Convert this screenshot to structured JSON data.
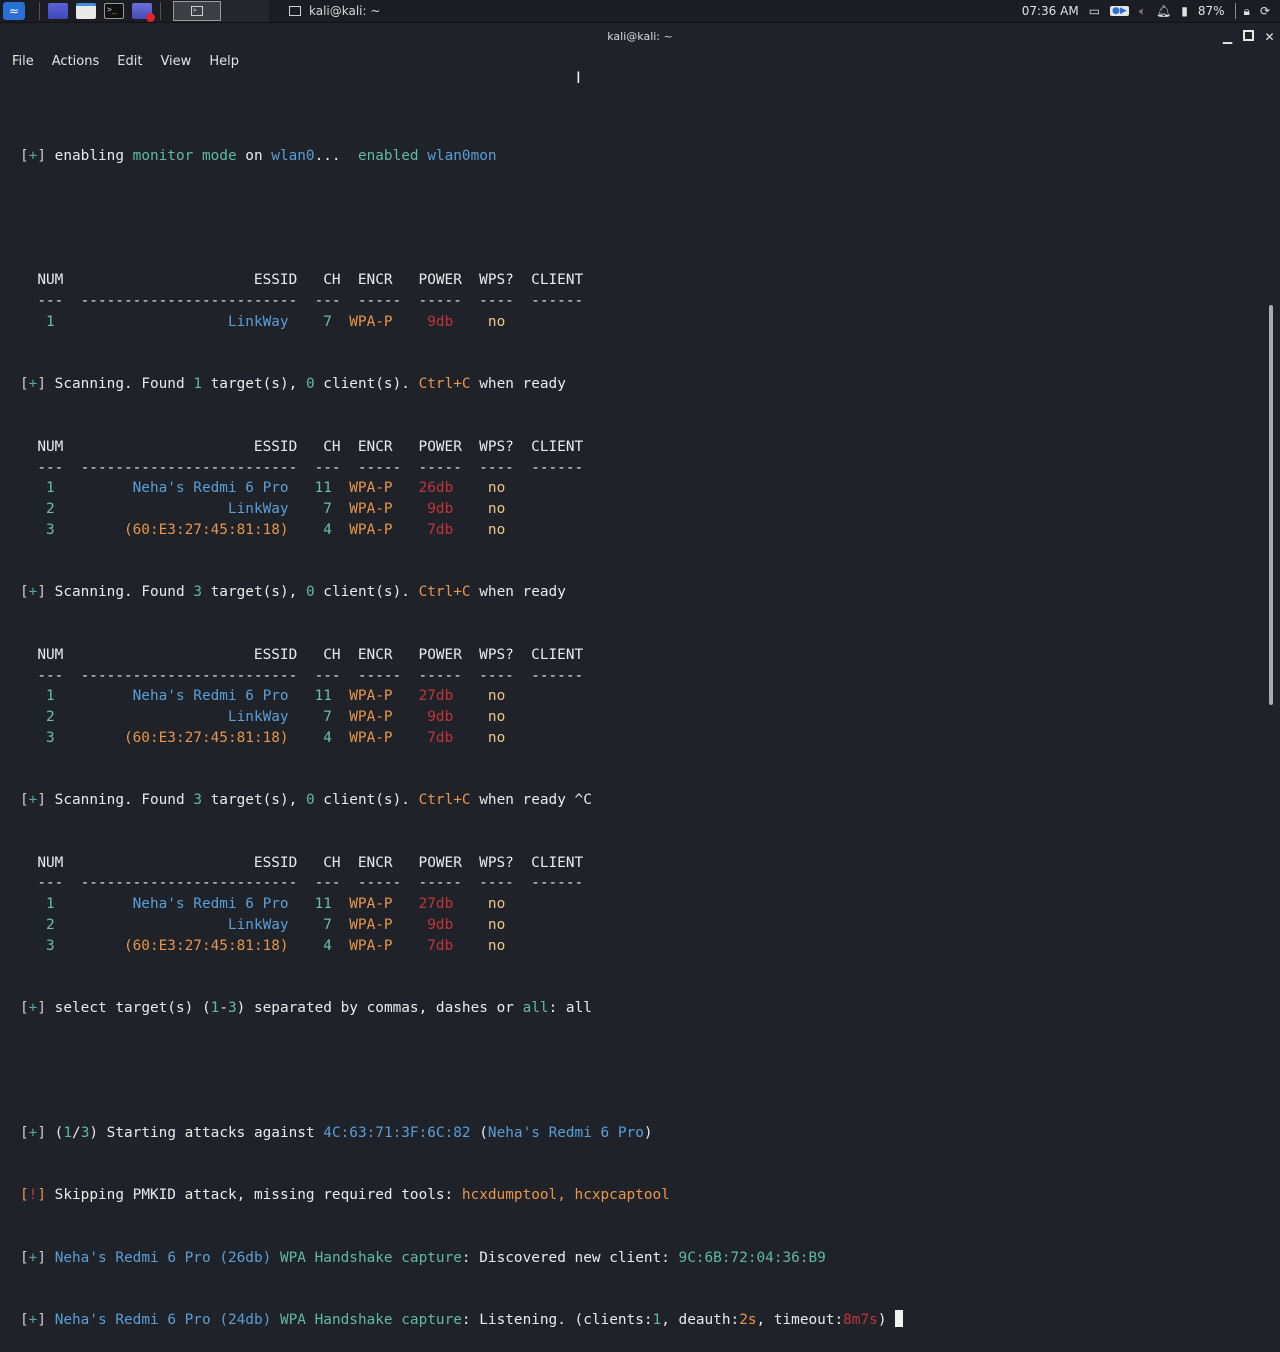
{
  "panel": {
    "taskbar_title": "kali@kali: ~",
    "tray": {
      "time": "07:36 AM",
      "battery": "87%"
    }
  },
  "window": {
    "title": "kali@kali: ~",
    "minimize": "▁",
    "close": "✕"
  },
  "menu": [
    "File",
    "Actions",
    "Edit",
    "View",
    "Help"
  ],
  "terminal": {
    "monitor_line": {
      "prefix": "[+]",
      "t1": " enabling ",
      "t2": "monitor mode",
      "t3": " on ",
      "t4": "wlan0",
      "t5": "...  ",
      "t6": "enabled",
      "t7": " ",
      "t8": "wlan0mon"
    },
    "header": "  NUM                      ESSID   CH  ENCR   POWER  WPS?  CLIENT",
    "divider": "  ---  -------------------------  ---  -----  -----  ----  ------",
    "scan1_rows": [
      {
        "num": "1",
        "essid": "LinkWay",
        "ch": "7",
        "encr": "WPA-P",
        "power": "9db",
        "wps": "no"
      }
    ],
    "scan1_status": {
      "found": "1",
      "clients": "0"
    },
    "scan2_rows": [
      {
        "num": "1",
        "essid": "Neha's Redmi 6 Pro",
        "ch": "11",
        "encr": "WPA-P",
        "power": "26db",
        "wps": "no"
      },
      {
        "num": "2",
        "essid": "LinkWay",
        "ch": "7",
        "encr": "WPA-P",
        "power": "9db",
        "wps": "no"
      },
      {
        "num": "3",
        "essid": "(60:E3:27:45:81:18)",
        "ch": "4",
        "encr": "WPA-P",
        "power": "7db",
        "wps": "no"
      }
    ],
    "scan2_status": {
      "found": "3",
      "clients": "0"
    },
    "scan3_rows": [
      {
        "num": "1",
        "essid": "Neha's Redmi 6 Pro",
        "ch": "11",
        "encr": "WPA-P",
        "power": "27db",
        "wps": "no"
      },
      {
        "num": "2",
        "essid": "LinkWay",
        "ch": "7",
        "encr": "WPA-P",
        "power": "9db",
        "wps": "no"
      },
      {
        "num": "3",
        "essid": "(60:E3:27:45:81:18)",
        "ch": "4",
        "encr": "WPA-P",
        "power": "7db",
        "wps": "no"
      }
    ],
    "scan3_status": {
      "found": "3",
      "clients": "0",
      "suffix": " ^C"
    },
    "scan4_rows": [
      {
        "num": "1",
        "essid": "Neha's Redmi 6 Pro",
        "ch": "11",
        "encr": "WPA-P",
        "power": "27db",
        "wps": "no"
      },
      {
        "num": "2",
        "essid": "LinkWay",
        "ch": "7",
        "encr": "WPA-P",
        "power": "9db",
        "wps": "no"
      },
      {
        "num": "3",
        "essid": "(60:E3:27:45:81:18)",
        "ch": "4",
        "encr": "WPA-P",
        "power": "7db",
        "wps": "no"
      }
    ],
    "scan_text": {
      "a": " Scanning. Found ",
      "b": " target(s), ",
      "c": " client(s). ",
      "ctrl": "Ctrl+C",
      "d": " when ready"
    },
    "select_line": {
      "a": " select target(s) (",
      "r1": "1",
      "dash": "-",
      "r2": "3",
      "b": ") separated by commas, dashes or ",
      "all": "all",
      "c": ": all"
    },
    "attack_line": {
      "a": " (",
      "i": "1",
      "slash": "/",
      "n": "3",
      "b": ") Starting attacks against ",
      "bssid": "4C:63:71:3F:6C:82",
      "c": " (",
      "essid": "Neha's Redmi 6 Pro",
      "d": ")"
    },
    "skip_line": {
      "prefix": "[!]",
      "a": " Skipping PMKID attack, missing required tools: ",
      "t1": "hcxdumptool",
      "comma": ", ",
      "t2": "hcxpcaptool"
    },
    "client_line": {
      "essid": "Neha's Redmi 6 Pro",
      "pwr": "(26db)",
      "cap": "WPA Handshake capture",
      "a": ": Discovered new client: ",
      "mac": "9C:6B:72:04:36:B9"
    },
    "listen_line": {
      "essid": "Neha's Redmi 6 Pro",
      "pwr": "(24db)",
      "cap": "WPA Handshake capture",
      "a": ": Listening. (clients:",
      "clients": "1",
      "b": ", deauth:",
      "deauth": "2s",
      "c": ", timeout:",
      "timeout": "8m7s",
      "d": ")"
    }
  }
}
